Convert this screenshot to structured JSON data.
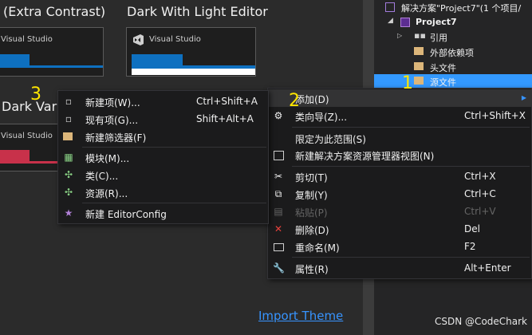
{
  "colors": {
    "accent": "#007acc",
    "selection": "#3399ff",
    "annotation": "#ffe600"
  },
  "themes": {
    "left_title": "(Extra Contrast)",
    "right_title": "Dark With Light Editor",
    "lower_title": "Dark Varia",
    "thumb_label": "Visual Studio",
    "import_link": "Import Theme"
  },
  "solution": {
    "root": "解决方案\"Project7\"(1 个项目/",
    "project": "Project7",
    "items": [
      "引用",
      "外部依赖项",
      "头文件",
      "源文件"
    ]
  },
  "menu_main": {
    "items": [
      {
        "label": "添加(D)",
        "shortcut": "",
        "icon": "blank",
        "submenu": true
      },
      {
        "label": "类向导(Z)...",
        "shortcut": "Ctrl+Shift+X",
        "icon": "class-wizard-icon"
      },
      {
        "label": "限定为此范围(S)",
        "shortcut": "",
        "icon": "blank"
      },
      {
        "label": "新建解决方案资源管理器视图(N)",
        "shortcut": "",
        "icon": "new-view-icon"
      },
      {
        "label": "剪切(T)",
        "shortcut": "Ctrl+X",
        "icon": "cut-icon"
      },
      {
        "label": "复制(Y)",
        "shortcut": "Ctrl+C",
        "icon": "copy-icon"
      },
      {
        "label": "粘贴(P)",
        "shortcut": "Ctrl+V",
        "icon": "paste-icon",
        "disabled": true
      },
      {
        "label": "删除(D)",
        "shortcut": "Del",
        "icon": "delete-icon"
      },
      {
        "label": "重命名(M)",
        "shortcut": "F2",
        "icon": "rename-icon"
      },
      {
        "label": "属性(R)",
        "shortcut": "Alt+Enter",
        "icon": "properties-icon"
      }
    ]
  },
  "menu_add": {
    "items": [
      {
        "label": "新建项(W)...",
        "shortcut": "Ctrl+Shift+A"
      },
      {
        "label": "现有项(G)...",
        "shortcut": "Shift+Alt+A"
      },
      {
        "label": "新建筛选器(F)",
        "shortcut": ""
      },
      {
        "label": "模块(M)...",
        "shortcut": ""
      },
      {
        "label": "类(C)...",
        "shortcut": ""
      },
      {
        "label": "资源(R)...",
        "shortcut": ""
      },
      {
        "label": "新建 EditorConfig",
        "shortcut": ""
      }
    ]
  },
  "annotations": {
    "one": "1",
    "two": "2",
    "three": "3"
  },
  "watermark": "CSDN @CodeChark"
}
